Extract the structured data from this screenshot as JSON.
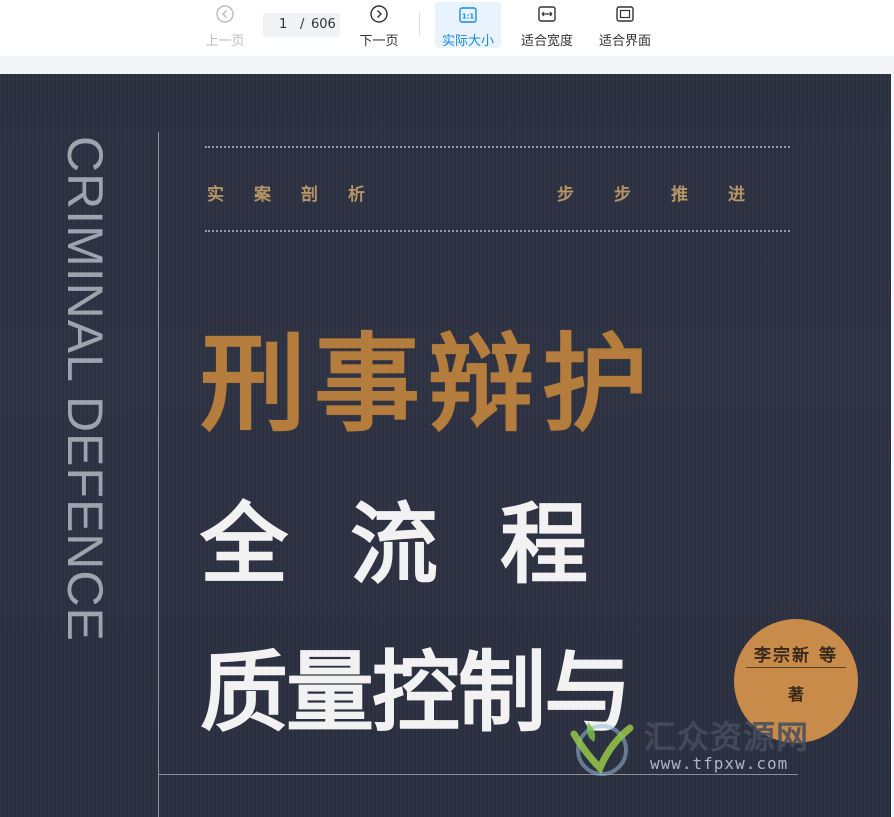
{
  "toolbar": {
    "prev_label": "上一页",
    "next_label": "下一页",
    "current_page": "1",
    "page_separator": "/",
    "total_pages": "606",
    "actual_size_icon_text": "1:1",
    "actual_size_label": "实际大小",
    "fit_width_label": "适合宽度",
    "fit_page_label": "适合界面",
    "active": "actual_size",
    "accent_color": "#1a8ae6"
  },
  "book_cover": {
    "spine_text": "CRIMINAL DEFENCE",
    "tagline_left": "实案剖析",
    "tagline_right": "步步推进",
    "title_main": "刑事辩护",
    "title_sub1": "全流程",
    "title_sub2": "质量控制与",
    "author_name": "李宗新 等",
    "author_role": "著",
    "title_color": "#b57d3d",
    "background_color": "#2c3140"
  },
  "watermark": {
    "name": "汇众资源网",
    "url": "www.tfpxw.com"
  }
}
